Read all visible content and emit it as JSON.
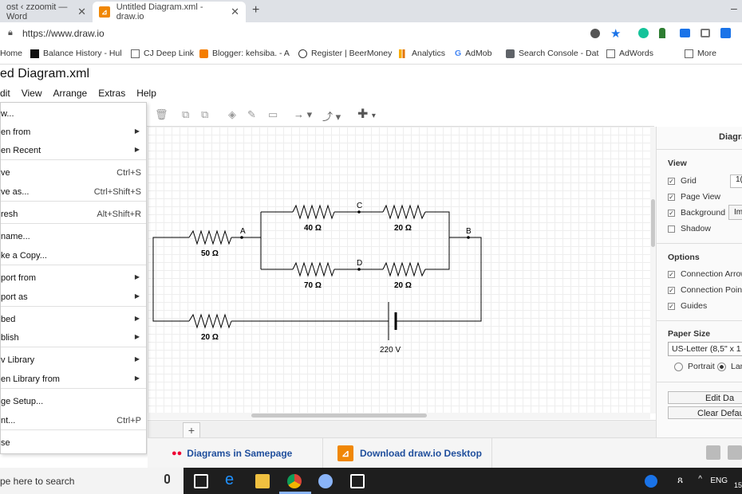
{
  "browser": {
    "tabs": [
      {
        "label": "ost ‹ zzoomit — Word"
      },
      {
        "label": "Untitled Diagram.xml - draw.io"
      }
    ],
    "new_tab": "+",
    "minimize": "–",
    "url": "https://www.draw.io",
    "bookmarks": [
      {
        "label": "Home",
        "icon": "page-icon"
      },
      {
        "label": "Balance History - Hul",
        "icon": "hub-icon"
      },
      {
        "label": "CJ Deep Link",
        "icon": "page-icon"
      },
      {
        "label": "Blogger: kehsiba. - A",
        "icon": "blogger-icon"
      },
      {
        "label": "Register | BeerMoney",
        "icon": "reddit-icon"
      },
      {
        "label": "Analytics",
        "icon": "analytics-icon"
      },
      {
        "label": "AdMob",
        "icon": "google-icon"
      },
      {
        "label": "Search Console - Dat",
        "icon": "search-console-icon"
      },
      {
        "label": "AdWords",
        "icon": "page-icon"
      },
      {
        "label": "More",
        "icon": "page-icon"
      }
    ]
  },
  "app": {
    "title": "ed Diagram.xml",
    "menu": [
      "dit",
      "View",
      "Arrange",
      "Extras",
      "Help"
    ]
  },
  "file_menu": {
    "items": [
      {
        "label": "w...",
        "shortcut": "",
        "submenu": false
      },
      {
        "label": "en from",
        "shortcut": "",
        "submenu": true
      },
      {
        "label": "en Recent",
        "shortcut": "",
        "submenu": true
      },
      {
        "label": "ve",
        "shortcut": "Ctrl+S",
        "submenu": false
      },
      {
        "label": "ve as...",
        "shortcut": "Ctrl+Shift+S",
        "submenu": false
      },
      {
        "label": "resh",
        "shortcut": "Alt+Shift+R",
        "submenu": false
      },
      {
        "label": "name...",
        "shortcut": "",
        "submenu": false
      },
      {
        "label": "ke a Copy...",
        "shortcut": "",
        "submenu": false
      },
      {
        "label": "port from",
        "shortcut": "",
        "submenu": true
      },
      {
        "label": "port as",
        "shortcut": "",
        "submenu": true
      },
      {
        "label": "bed",
        "shortcut": "",
        "submenu": true
      },
      {
        "label": "blish",
        "shortcut": "",
        "submenu": true
      },
      {
        "label": "v Library",
        "shortcut": "",
        "submenu": true
      },
      {
        "label": "en Library from",
        "shortcut": "",
        "submenu": true
      },
      {
        "label": "ge Setup...",
        "shortcut": "",
        "submenu": false
      },
      {
        "label": "nt...",
        "shortcut": "Ctrl+P",
        "submenu": false
      },
      {
        "label": "se",
        "shortcut": "",
        "submenu": false
      }
    ]
  },
  "diagram": {
    "nodes": [
      "A",
      "B",
      "C",
      "D"
    ],
    "resistors": [
      "50 Ω",
      "40 Ω",
      "20 Ω",
      "70 Ω",
      "20 Ω",
      "20 Ω"
    ],
    "battery": "220 V"
  },
  "right_panel": {
    "title": "Diagra",
    "view_header": "View",
    "view": [
      {
        "label": "Grid",
        "checked": true
      },
      {
        "label": "Page View",
        "checked": true
      },
      {
        "label": "Background",
        "checked": true
      },
      {
        "label": "Shadow",
        "checked": false
      }
    ],
    "grid_value": "1(",
    "background_button": "Im",
    "options_header": "Options",
    "options": [
      {
        "label": "Connection Arrow",
        "checked": true
      },
      {
        "label": "Connection Points",
        "checked": true
      },
      {
        "label": "Guides",
        "checked": true
      }
    ],
    "paper_header": "Paper Size",
    "paper_size": "US-Letter (8,5\" x 1",
    "orientation": [
      "Portrait",
      "Lan"
    ],
    "edit_button": "Edit Da",
    "clear_button": "Clear Defau"
  },
  "footer": {
    "samepage": "Diagrams in Samepage",
    "download": "Download draw.io Desktop"
  },
  "taskbar": {
    "search": "pe here to search",
    "language": "ENG",
    "time": "15"
  },
  "colors": {
    "accent": "#f08705",
    "link": "#1f4e9c",
    "taskbar": "#1e1e1e"
  }
}
